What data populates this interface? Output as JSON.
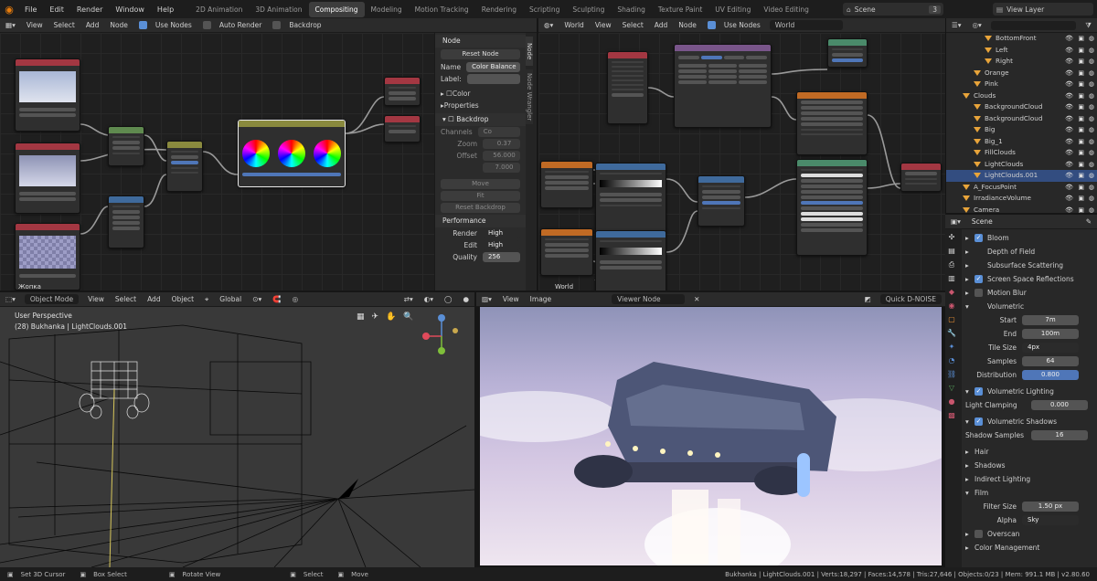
{
  "topbar": {
    "menus": [
      "File",
      "Edit",
      "Render",
      "Window",
      "Help"
    ],
    "workspaces": [
      {
        "label": "2D Animation",
        "active": false
      },
      {
        "label": "3D Animation",
        "active": false
      },
      {
        "label": "Compositing",
        "active": true
      },
      {
        "label": "Modeling",
        "active": false
      },
      {
        "label": "Motion Tracking",
        "active": false
      },
      {
        "label": "Rendering",
        "active": false
      },
      {
        "label": "Scripting",
        "active": false
      },
      {
        "label": "Sculpting",
        "active": false
      },
      {
        "label": "Shading",
        "active": false
      },
      {
        "label": "Texture Paint",
        "active": false
      },
      {
        "label": "UV Editing",
        "active": false
      },
      {
        "label": "Video Editing",
        "active": false
      }
    ],
    "scene_label": "Scene",
    "scene_count": "3",
    "view_layer_label": "View Layer"
  },
  "compositor_header": {
    "view": "View",
    "select": "Select",
    "add": "Add",
    "node": "Node",
    "use_nodes": "Use Nodes",
    "auto_render": "Auto Render",
    "backdrop": "Backdrop"
  },
  "compositor_nodes": {
    "bottom_label": "Жопка"
  },
  "node_sidebar": {
    "section_node": "Node",
    "reset_node": "Reset Node",
    "name_label": "Name",
    "name_value": "Color Balance",
    "label_label": "Label:",
    "color_label": "Color",
    "properties_label": "Properties",
    "backdrop_label": "Backdrop",
    "channels_label": "Channels",
    "channels_value": "Co",
    "zoom_label": "Zoom",
    "zoom_value": "0.37",
    "offset_label": "Offset",
    "offset_x": "56.000",
    "offset_y": "7.000",
    "move_btn": "Move",
    "fit_btn": "Fit",
    "reset_backdrop_btn": "Reset Backdrop",
    "performance_label": "Performance",
    "render_label": "Render",
    "render_value": "High",
    "edit_label": "Edit",
    "edit_value": "High",
    "quality_label": "Quality",
    "quality_value": "256",
    "tab_node": "Node",
    "tab_wrangler": "Node Wrangler"
  },
  "world_header": {
    "object_type": "World",
    "view": "View",
    "select": "Select",
    "add": "Add",
    "node": "Node",
    "use_nodes": "Use Nodes",
    "world_name": "World"
  },
  "world_nodes": {
    "bottom_label": "World"
  },
  "outliner": {
    "rows": [
      {
        "label": "BottomFront",
        "indent": 3,
        "selected": false
      },
      {
        "label": "Left",
        "indent": 3,
        "selected": false
      },
      {
        "label": "Right",
        "indent": 3,
        "selected": false
      },
      {
        "label": "Orange",
        "indent": 2,
        "selected": false
      },
      {
        "label": "Pink",
        "indent": 2,
        "selected": false
      },
      {
        "label": "Clouds",
        "indent": 1,
        "selected": false
      },
      {
        "label": "BackgroundCloud",
        "indent": 2,
        "selected": false
      },
      {
        "label": "BackgroundCloud",
        "indent": 2,
        "selected": false
      },
      {
        "label": "Big",
        "indent": 2,
        "selected": false
      },
      {
        "label": "Big_1",
        "indent": 2,
        "selected": false
      },
      {
        "label": "FillClouds",
        "indent": 2,
        "selected": false
      },
      {
        "label": "LightClouds",
        "indent": 2,
        "selected": false
      },
      {
        "label": "LightClouds.001",
        "indent": 2,
        "selected": true
      },
      {
        "label": "A_FocusPoint",
        "indent": 1,
        "selected": false
      },
      {
        "label": "IrradianceVolume",
        "indent": 1,
        "selected": false
      },
      {
        "label": "Camera",
        "indent": 1,
        "selected": false
      }
    ]
  },
  "properties": {
    "scene_label": "Scene",
    "bloom": "Bloom",
    "depth_of_field": "Depth of Field",
    "subsurface": "Subsurface Scattering",
    "ssr": "Screen Space Reflections",
    "motion_blur": "Motion Blur",
    "volumetric": "Volumetric",
    "start_label": "Start",
    "start_value": "7m",
    "end_label": "End",
    "end_value": "100m",
    "tile_size_label": "Tile Size",
    "tile_size_value": "4px",
    "samples_label": "Samples",
    "samples_value": "64",
    "distribution_label": "Distribution",
    "distribution_value": "0.800",
    "vol_lighting": "Volumetric Lighting",
    "light_clamping_label": "Light Clamping",
    "light_clamping_value": "0.000",
    "vol_shadows": "Volumetric Shadows",
    "shadow_samples_label": "Shadow Samples",
    "shadow_samples_value": "16",
    "hair": "Hair",
    "shadows": "Shadows",
    "indirect": "Indirect Lighting",
    "film": "Film",
    "filter_size_label": "Filter Size",
    "filter_size_value": "1.50 px",
    "alpha_label": "Alpha",
    "alpha_value": "Sky",
    "overscan": "Overscan",
    "color_mgmt": "Color Management"
  },
  "viewport_header": {
    "mode": "Object Mode",
    "view": "View",
    "select": "Select",
    "add": "Add",
    "object": "Object",
    "orientation": "Global"
  },
  "viewport": {
    "perspective": "User Perspective",
    "object_info": "(28) Bukhanka | LightClouds.001"
  },
  "image_header": {
    "view": "View",
    "image": "Image",
    "viewer_node": "Viewer Node",
    "quick_denoise": "Quick D-NOISE"
  },
  "statusbar": {
    "set_cursor": "Set 3D Cursor",
    "box_select": "Box Select",
    "rotate_view": "Rotate View",
    "select": "Select",
    "move": "Move",
    "stats": "Bukhanka | LightClouds.001 | Verts:18,297 | Faces:14,578 | Tris:27,646 | Objects:0/23 | Mem: 991.1 MB | v2.80.60"
  },
  "colors": {
    "accent_blue": "#4f76b8",
    "active_orange": "#e87d0d",
    "selection": "#334d80"
  }
}
